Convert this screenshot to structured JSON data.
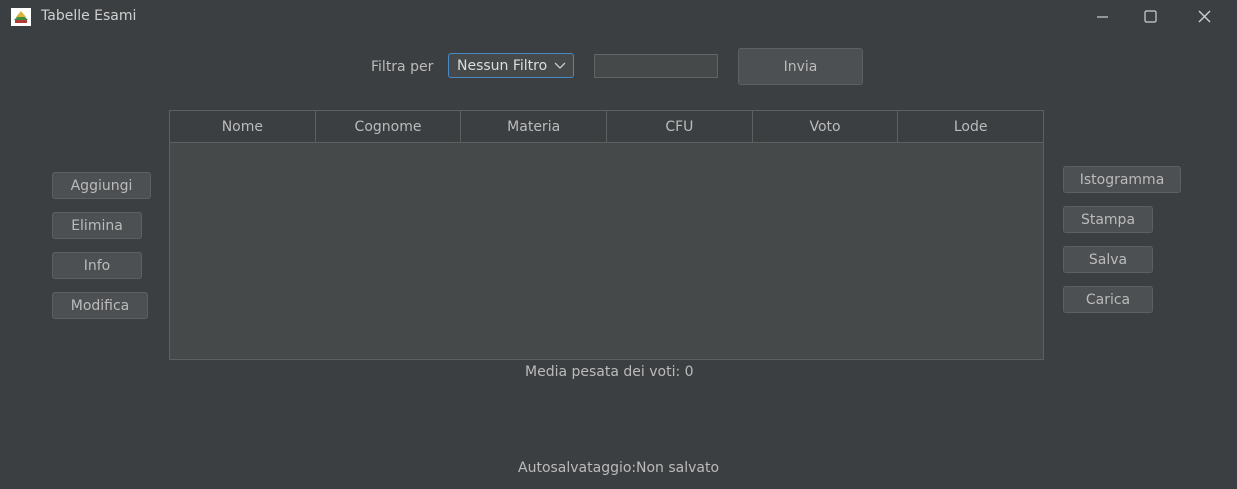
{
  "window": {
    "title": "Tabelle Esami",
    "controls": [
      "minimize-icon",
      "maximize-icon",
      "close-icon"
    ]
  },
  "filter": {
    "label": "Filtra per",
    "selected": "Nessun Filtro",
    "input_value": "",
    "submit_label": "Invia"
  },
  "table": {
    "columns": [
      "Nome",
      "Cognome",
      "Materia",
      "CFU",
      "Voto",
      "Lode"
    ],
    "rows": []
  },
  "left_actions": {
    "add": "Aggiungi",
    "delete": "Elimina",
    "info": "Info",
    "edit": "Modifica"
  },
  "right_actions": {
    "histogram": "Istogramma",
    "print": "Stampa",
    "save": "Salva",
    "load": "Carica"
  },
  "status": {
    "weighted_average": "Media pesata dei voti: 0",
    "autosave_label": "Autosalvataggio:",
    "autosave_value": "Non salvato"
  },
  "colors": {
    "background": "#3c3f41",
    "focus_border": "#4a88c7"
  }
}
